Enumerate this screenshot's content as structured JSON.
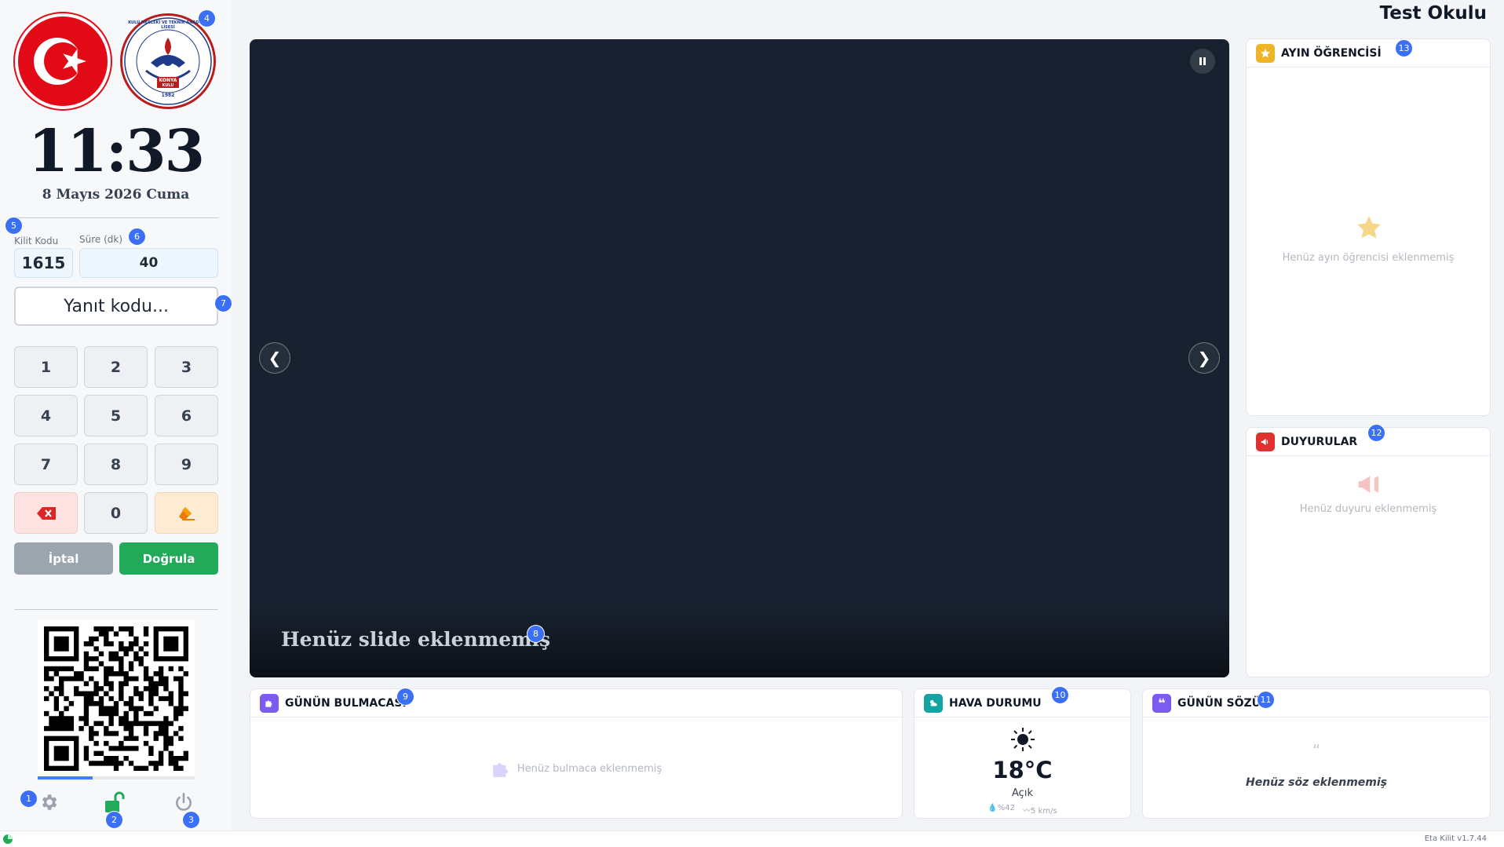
{
  "header": {
    "school_name": "Test Okulu"
  },
  "sidebar": {
    "clock": "11:33",
    "date": "8 Mayıs 2026 Cuma",
    "lock_code_label": "Kilit Kodu",
    "lock_code_value": "1615",
    "duration_label": "Süre (dk)",
    "duration_value": "40",
    "answer_placeholder": "Yanıt kodu...",
    "keys": [
      "1",
      "2",
      "3",
      "4",
      "5",
      "6",
      "7",
      "8",
      "9",
      "0"
    ],
    "cancel_label": "İptal",
    "verify_label": "Doğrula",
    "logo_text": {
      "top": "KULU MESLEKİ VE TEKNİK ANADOLU LİSESİ",
      "city": "KONYA",
      "town": "KULU",
      "year": "1982"
    }
  },
  "slide": {
    "caption": "Henüz slide eklenmemiş",
    "prev": "❮",
    "next": "❯"
  },
  "cards": {
    "student_of_month": {
      "title": "AYIN ÖĞRENCİSİ",
      "empty": "Henüz ayın öğrencisi eklenmemiş"
    },
    "announcements": {
      "title": "DUYURULAR",
      "empty": "Henüz duyuru eklenmemiş"
    },
    "puzzle": {
      "title": "GÜNÜN BULMACASI",
      "empty": "Henüz bulmaca eklenmemiş"
    },
    "weather": {
      "title": "HAVA DURUMU",
      "temp": "18°C",
      "condition": "Açık",
      "humidity": "%42",
      "wind": "5 km/s"
    },
    "quote": {
      "title": "GÜNÜN SÖZÜ",
      "mark": "“",
      "empty": "Henüz söz eklenmemiş"
    }
  },
  "badges": [
    "1",
    "2",
    "3",
    "4",
    "5",
    "6",
    "7",
    "8",
    "9",
    "10",
    "11",
    "12",
    "13"
  ],
  "footer": {
    "version": "Eta Kilit v1.7.44"
  },
  "colors": {
    "accent_blue": "#3b6ff6",
    "verify_green": "#22a95a",
    "cancel_gray": "#9aa5ae",
    "slide_bg": "#18212f",
    "flag_red": "#e30a17"
  }
}
